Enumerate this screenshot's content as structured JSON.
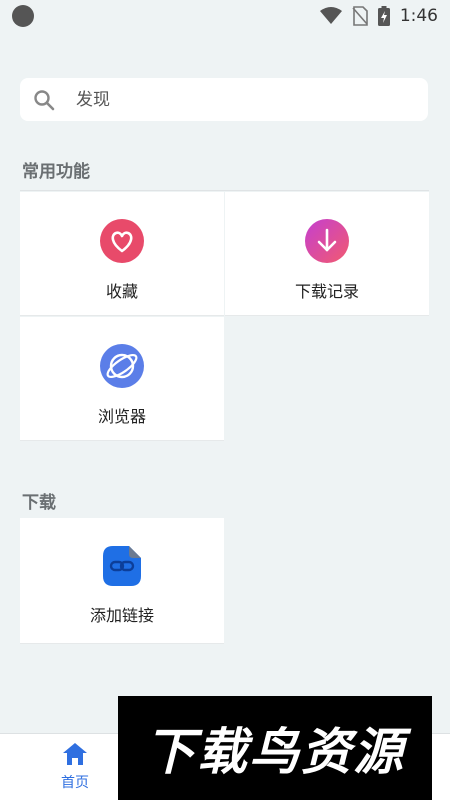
{
  "status_bar": {
    "time": "1:46",
    "icons": [
      "wifi-icon",
      "no-sim-icon",
      "battery-charging-icon"
    ]
  },
  "search": {
    "placeholder": "发现",
    "icon": "search-icon"
  },
  "sections": [
    {
      "title": "常用功能",
      "items": [
        {
          "label": "收藏",
          "icon": "heart-icon",
          "color": "#e84a6a"
        },
        {
          "label": "下载记录",
          "icon": "download-icon",
          "color": "#e8568a"
        },
        {
          "label": "浏览器",
          "icon": "planet-icon",
          "color": "#5b7ee8"
        }
      ]
    },
    {
      "title": "下载",
      "items": [
        {
          "label": "添加链接",
          "icon": "link-folder-icon",
          "color": "#2f6fe0"
        }
      ]
    }
  ],
  "bottom_nav": {
    "items": [
      {
        "label": "首页",
        "icon": "home-icon",
        "active": true,
        "color": "#2f6fe0"
      }
    ]
  },
  "watermark": {
    "text": "下载鸟资源"
  }
}
